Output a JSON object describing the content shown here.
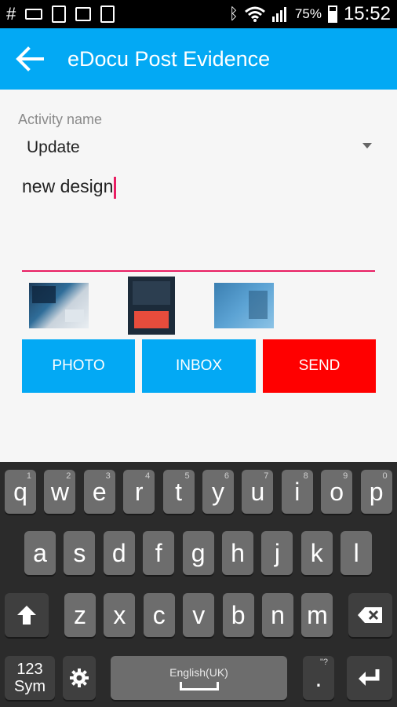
{
  "status_bar": {
    "left_icons": [
      "hash-icon",
      "keyboard-icon",
      "sim-icon",
      "image-icon",
      "clipboard-icon"
    ],
    "right_icons": [
      "bluetooth-icon",
      "wifi-icon",
      "signal-icon",
      "battery-icon"
    ],
    "battery_percent": "75%",
    "time": "15:52"
  },
  "app_bar": {
    "title": "eDocu Post Evidence",
    "color": "#03a9f4"
  },
  "form": {
    "activity_label": "Activity name",
    "activity_value": "Update",
    "text_value": "new design"
  },
  "buttons": {
    "photo": "PHOTO",
    "inbox": "INBOX",
    "send": "SEND",
    "photo_color": "#03a9f4",
    "inbox_color": "#03a9f4",
    "send_color": "#ff0000"
  },
  "keyboard": {
    "row1": [
      {
        "label": "q",
        "hint": "1"
      },
      {
        "label": "w",
        "hint": "2"
      },
      {
        "label": "e",
        "hint": "3"
      },
      {
        "label": "r",
        "hint": "4"
      },
      {
        "label": "t",
        "hint": "5"
      },
      {
        "label": "y",
        "hint": "6"
      },
      {
        "label": "u",
        "hint": "7"
      },
      {
        "label": "i",
        "hint": "8"
      },
      {
        "label": "o",
        "hint": "9"
      },
      {
        "label": "p",
        "hint": "0"
      }
    ],
    "row2": [
      "a",
      "s",
      "d",
      "f",
      "g",
      "h",
      "j",
      "k",
      "l"
    ],
    "row3": [
      "z",
      "x",
      "c",
      "v",
      "b",
      "n",
      "m"
    ],
    "sym_label_1": "123",
    "sym_label_2": "Sym",
    "space_label": "English(UK)",
    "period_label": ".",
    "period_hint": "\"?"
  }
}
